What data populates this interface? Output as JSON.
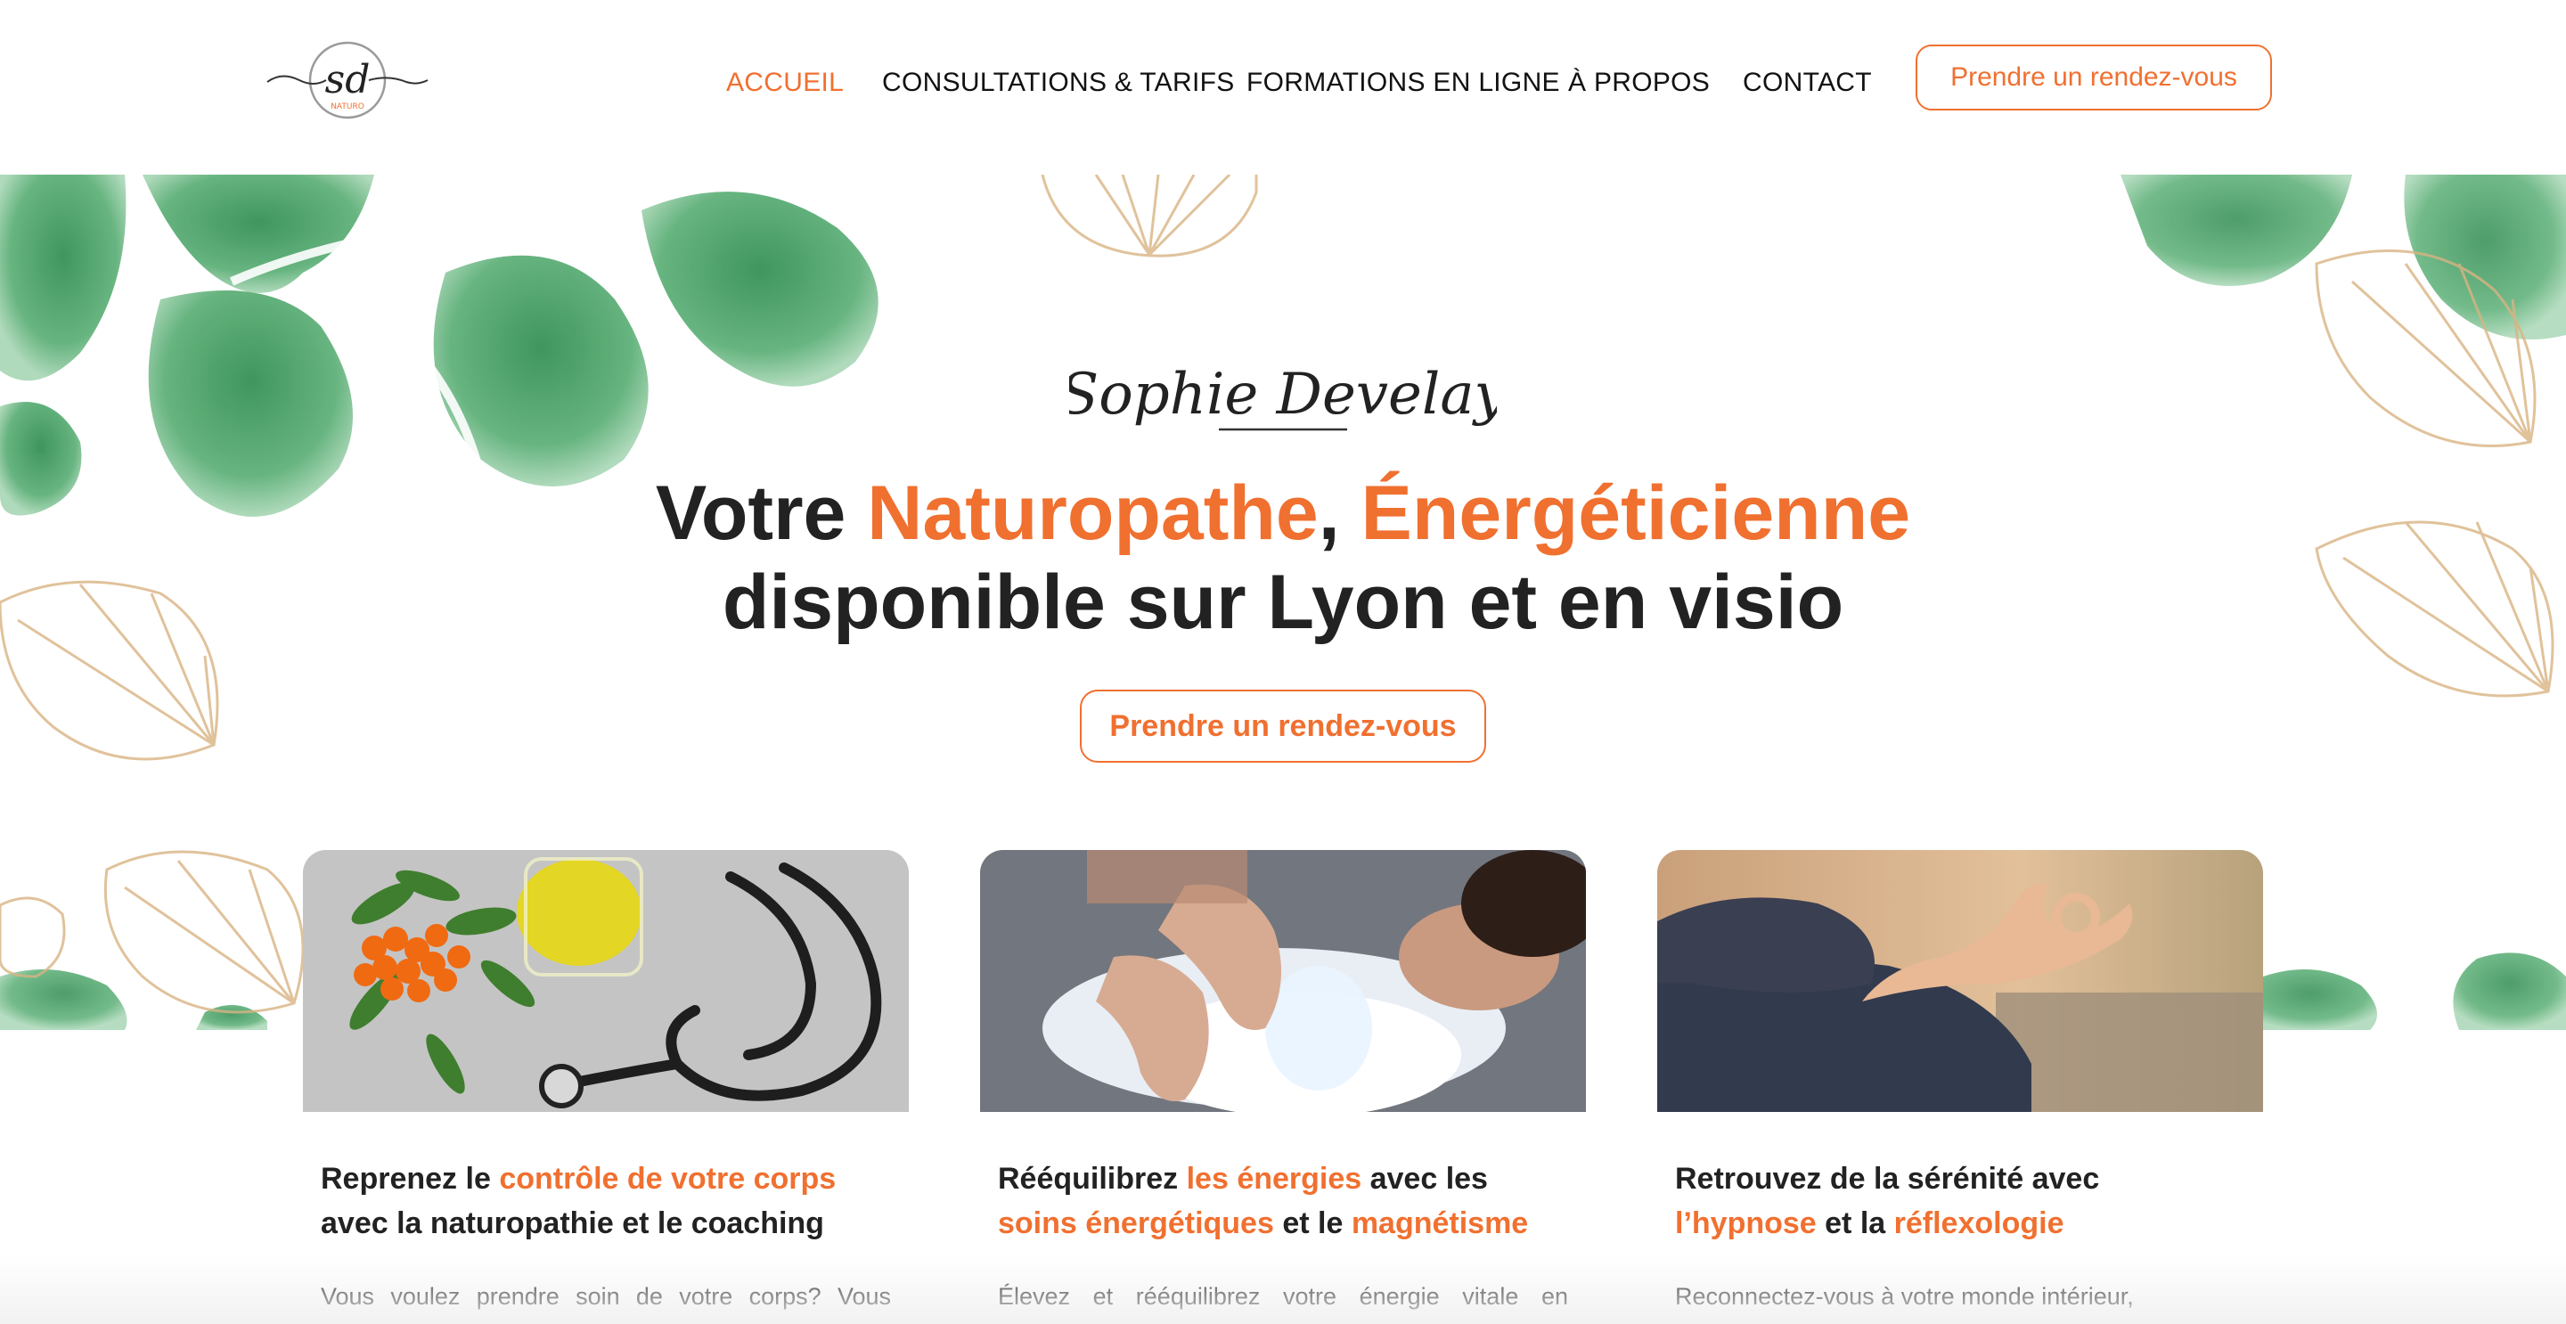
{
  "logo": {
    "initials": "sd",
    "tag": "NATURO"
  },
  "nav": {
    "items": [
      {
        "label": "ACCUEIL",
        "active": true
      },
      {
        "label": "CONSULTATIONS & TARIFS",
        "active": false
      },
      {
        "label": "FORMATIONS EN LIGNE",
        "active": false
      },
      {
        "label": "À PROPOS",
        "active": false
      },
      {
        "label": "CONTACT",
        "active": false
      }
    ],
    "cta_label": "Prendre un rendez-vous"
  },
  "hero": {
    "signature": "Sophie Develay",
    "title_parts": [
      "Votre ",
      "Naturopathe",
      ", ",
      "Énergéticienne"
    ],
    "title_line2": "disponible sur Lyon et en visio",
    "cta_label": "Prendre un rendez-vous"
  },
  "cards": [
    {
      "image": "rowan-berries-oil-stethoscope",
      "title_parts": [
        "Reprenez le ",
        "contrôle de votre corps"
      ],
      "title_line2": "avec la naturopathie et le coaching",
      "text": "Vous voulez prendre soin de votre corps? Vous"
    },
    {
      "image": "energy-healing-hands",
      "title_parts": [
        "Rééquilibrez ",
        "les énergies",
        " avec les"
      ],
      "title_line2_parts": [
        "soins énergétiques",
        " et le ",
        "magnétisme"
      ],
      "text": "Élevez et rééquilibrez votre énergie vitale en"
    },
    {
      "image": "meditation-hand",
      "title_line1": "Retrouvez de la sérénité avec",
      "title_line2_parts": [
        "l’hypnose",
        " et la ",
        "réflexologie"
      ],
      "text": "Reconnectez-vous à votre monde intérieur,"
    }
  ],
  "colors": {
    "accent": "#f07030",
    "text": "#222222",
    "leaf_green": "#3f9a5c",
    "line_gold": "#d9b483"
  }
}
